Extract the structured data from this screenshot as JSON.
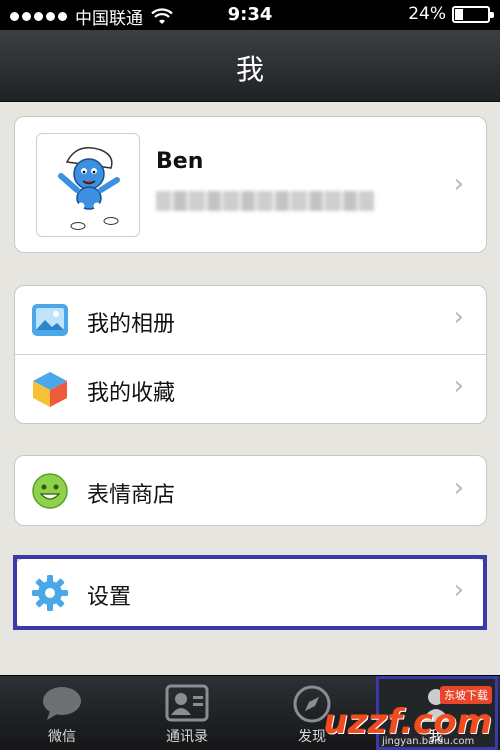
{
  "status_bar": {
    "carrier": "中国联通",
    "time": "9:34",
    "battery_percent_label": "24%",
    "battery_level": 0.24
  },
  "nav": {
    "title": "我"
  },
  "profile": {
    "name": "Ben"
  },
  "menu_group_1": [
    {
      "label": "我的相册",
      "icon": "photo-album-icon"
    },
    {
      "label": "我的收藏",
      "icon": "favorites-cube-icon"
    }
  ],
  "menu_group_2": [
    {
      "label": "表情商店",
      "icon": "smiley-icon"
    }
  ],
  "menu_group_3": [
    {
      "label": "设置",
      "icon": "gear-icon"
    }
  ],
  "tabbar": {
    "items": [
      {
        "label": "微信",
        "icon": "chat-bubble-icon"
      },
      {
        "label": "通讯录",
        "icon": "contacts-card-icon"
      },
      {
        "label": "发现",
        "icon": "compass-icon"
      },
      {
        "label": "我",
        "icon": "person-icon"
      }
    ]
  },
  "watermark": {
    "logo": "uzzf.com",
    "tag": "东坡下载",
    "sub": "jingyan.baidu.com"
  },
  "colors": {
    "highlight": "#3a3aa8",
    "nav_bg": "#2a2d31",
    "page_bg": "#e6e5e0"
  }
}
